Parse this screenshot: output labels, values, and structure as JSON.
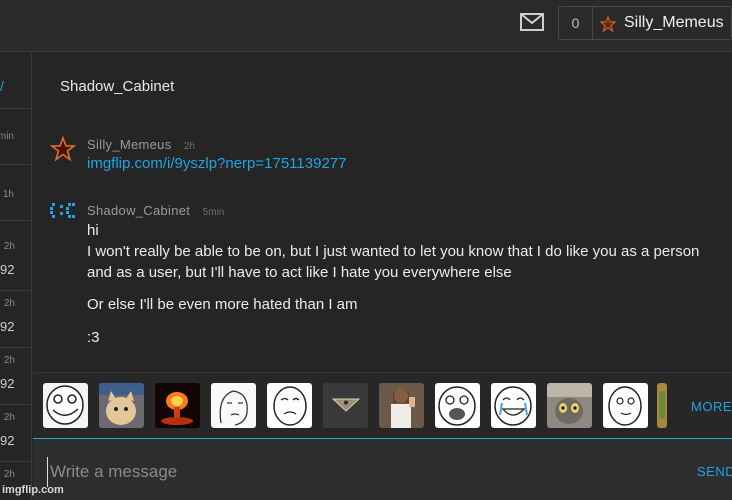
{
  "header": {
    "icons": [
      "mail-icon",
      "star-icon"
    ],
    "notification_count": "0",
    "username": "Silly_Memeus"
  },
  "sidebar": {
    "items": [
      {
        "time": "min",
        "value": ""
      },
      {
        "time": "1h",
        "value": ""
      },
      {
        "time": "2h",
        "value": "92"
      },
      {
        "time": "2h",
        "value": "92"
      },
      {
        "time": "2h",
        "value": "92"
      },
      {
        "time": "2h",
        "value": "92"
      },
      {
        "time": "2h",
        "value": ""
      }
    ]
  },
  "conversation": {
    "title": "Shadow_Cabinet",
    "messages": [
      {
        "user": "Silly_Memeus",
        "time": "2h",
        "avatar": "star-avatar",
        "link": "imgflip.com/i/9yszlp?nerp=1751139277"
      },
      {
        "user": "Shadow_Cabinet",
        "time": "5min",
        "avatar": "pixel-face-avatar",
        "lines": [
          "hi",
          "I won't really be able to be on, but I just wanted to let you know that I do like you as a person and as a user, but I'll have to act like I hate you everywhere else",
          "Or else I'll be even more hated than I am",
          ":3"
        ]
      }
    ]
  },
  "meme_strip": {
    "more_label": "MORE",
    "thumbs": [
      "troll-face",
      "cat-meme",
      "explosion",
      "wojak",
      "okay-face",
      "illuminati-triangle",
      "buddy-christ",
      "lol-face",
      "crying-happy-face",
      "gru-cat",
      "thinking-face",
      "partial-thumb"
    ]
  },
  "composer": {
    "placeholder": "Write a message",
    "send_label": "SEND"
  },
  "watermark": "imgflip.com",
  "colors": {
    "accent": "#1fa5e6",
    "background": "#252525",
    "star": "#c0392b"
  }
}
